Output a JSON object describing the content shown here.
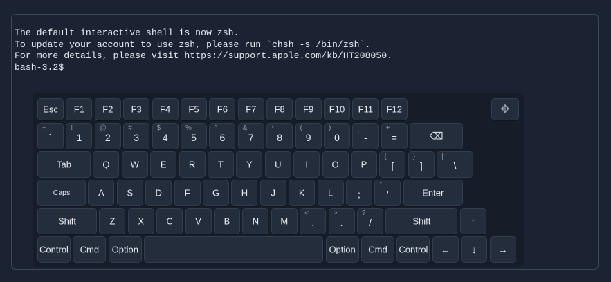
{
  "terminal": {
    "lines": [
      "The default interactive shell is now zsh.",
      "To update your account to use zsh, please run `chsh -s /bin/zsh`.",
      "For more details, please visit https://support.apple.com/kb/HT208050.",
      "bash-3.2$"
    ]
  },
  "keyboard": {
    "move_icon": "✥",
    "rows": [
      [
        {
          "label": "Esc",
          "name": "esc"
        },
        {
          "label": "F1",
          "name": "f1"
        },
        {
          "label": "F2",
          "name": "f2"
        },
        {
          "label": "F3",
          "name": "f3"
        },
        {
          "label": "F4",
          "name": "f4"
        },
        {
          "label": "F5",
          "name": "f5"
        },
        {
          "label": "F6",
          "name": "f6"
        },
        {
          "label": "F7",
          "name": "f7"
        },
        {
          "label": "F8",
          "name": "f8"
        },
        {
          "label": "F9",
          "name": "f9"
        },
        {
          "label": "F10",
          "name": "f10"
        },
        {
          "label": "F11",
          "name": "f11"
        },
        {
          "label": "F12",
          "name": "f12"
        }
      ],
      [
        {
          "label": "`",
          "shift": "~",
          "name": "backtick"
        },
        {
          "label": "1",
          "shift": "!",
          "name": "1"
        },
        {
          "label": "2",
          "shift": "@",
          "name": "2"
        },
        {
          "label": "3",
          "shift": "#",
          "name": "3"
        },
        {
          "label": "4",
          "shift": "$",
          "name": "4"
        },
        {
          "label": "5",
          "shift": "%",
          "name": "5"
        },
        {
          "label": "6",
          "shift": "^",
          "name": "6"
        },
        {
          "label": "7",
          "shift": "&",
          "name": "7"
        },
        {
          "label": "8",
          "shift": "*",
          "name": "8"
        },
        {
          "label": "9",
          "shift": "(",
          "name": "9"
        },
        {
          "label": "0",
          "shift": ")",
          "name": "0"
        },
        {
          "label": "-",
          "shift": "_",
          "name": "minus"
        },
        {
          "label": "=",
          "shift": "+",
          "name": "equals"
        },
        {
          "label": "⌫",
          "name": "backspace",
          "icon": "backspace-icon"
        }
      ],
      [
        {
          "label": "Tab",
          "name": "tab"
        },
        {
          "label": "Q",
          "name": "q"
        },
        {
          "label": "W",
          "name": "w"
        },
        {
          "label": "E",
          "name": "e"
        },
        {
          "label": "R",
          "name": "r"
        },
        {
          "label": "T",
          "name": "t"
        },
        {
          "label": "Y",
          "name": "y"
        },
        {
          "label": "U",
          "name": "u"
        },
        {
          "label": "I",
          "name": "i"
        },
        {
          "label": "O",
          "name": "o"
        },
        {
          "label": "P",
          "name": "p"
        },
        {
          "label": "[",
          "shift": "{",
          "name": "lbracket"
        },
        {
          "label": "]",
          "shift": "}",
          "name": "rbracket"
        },
        {
          "label": "\\",
          "shift": "|",
          "name": "backslash"
        }
      ],
      [
        {
          "label": "Caps",
          "name": "caps"
        },
        {
          "label": "A",
          "name": "a"
        },
        {
          "label": "S",
          "name": "s"
        },
        {
          "label": "D",
          "name": "d"
        },
        {
          "label": "F",
          "name": "f"
        },
        {
          "label": "G",
          "name": "g"
        },
        {
          "label": "H",
          "name": "h"
        },
        {
          "label": "J",
          "name": "j"
        },
        {
          "label": "K",
          "name": "k"
        },
        {
          "label": "L",
          "name": "l"
        },
        {
          "label": ";",
          "shift": ":",
          "name": "semicolon"
        },
        {
          "label": "'",
          "shift": "\"",
          "name": "quote"
        },
        {
          "label": "Enter",
          "name": "enter"
        }
      ],
      [
        {
          "label": "Shift",
          "name": "shift-left"
        },
        {
          "label": "Z",
          "name": "z"
        },
        {
          "label": "X",
          "name": "x"
        },
        {
          "label": "C",
          "name": "c"
        },
        {
          "label": "V",
          "name": "v"
        },
        {
          "label": "B",
          "name": "b"
        },
        {
          "label": "N",
          "name": "n"
        },
        {
          "label": "M",
          "name": "m"
        },
        {
          "label": ",",
          "shift": "<",
          "name": "comma"
        },
        {
          "label": ".",
          "shift": ">",
          "name": "period"
        },
        {
          "label": "/",
          "shift": "?",
          "name": "slash"
        },
        {
          "label": "Shift",
          "name": "shift-right"
        },
        {
          "label": "↑",
          "name": "arrow-up",
          "icon": "arrow-up-icon"
        }
      ],
      [
        {
          "label": "Control",
          "name": "control-left"
        },
        {
          "label": "Cmd",
          "name": "cmd-left"
        },
        {
          "label": "Option",
          "name": "option-left"
        },
        {
          "label": "",
          "name": "space"
        },
        {
          "label": "Option",
          "name": "option-right"
        },
        {
          "label": "Cmd",
          "name": "cmd-right"
        },
        {
          "label": "Control",
          "name": "control-right"
        },
        {
          "label": "←",
          "name": "arrow-left",
          "icon": "arrow-left-icon"
        },
        {
          "label": "↓",
          "name": "arrow-down",
          "icon": "arrow-down-icon"
        },
        {
          "label": "→",
          "name": "arrow-right",
          "icon": "arrow-right-icon"
        }
      ]
    ]
  }
}
